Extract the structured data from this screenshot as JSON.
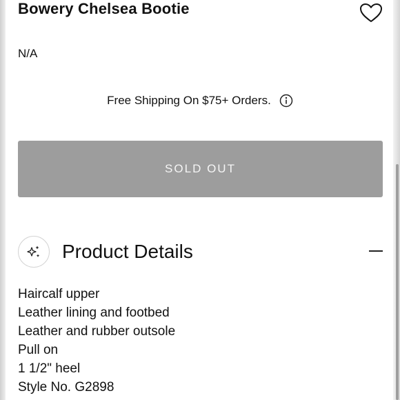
{
  "product": {
    "title": "Bowery Chelsea Bootie",
    "price": "N/A"
  },
  "shipping": {
    "text": "Free Shipping On $75+ Orders."
  },
  "buy_button": {
    "label": "SOLD OUT"
  },
  "details": {
    "heading": "Product Details",
    "items": [
      "Haircalf upper",
      "Leather lining and footbed",
      "Leather and rubber outsole",
      "Pull on",
      "1 1/2\" heel",
      "Style No. G2898"
    ]
  },
  "icons": {
    "wishlist": "heart-icon",
    "info": "info-icon",
    "details": "sparkle-icon",
    "collapse": "minus-icon"
  },
  "colors": {
    "button_bg": "#9d9d9d",
    "button_text": "#f5f5f5",
    "text": "#111111"
  }
}
